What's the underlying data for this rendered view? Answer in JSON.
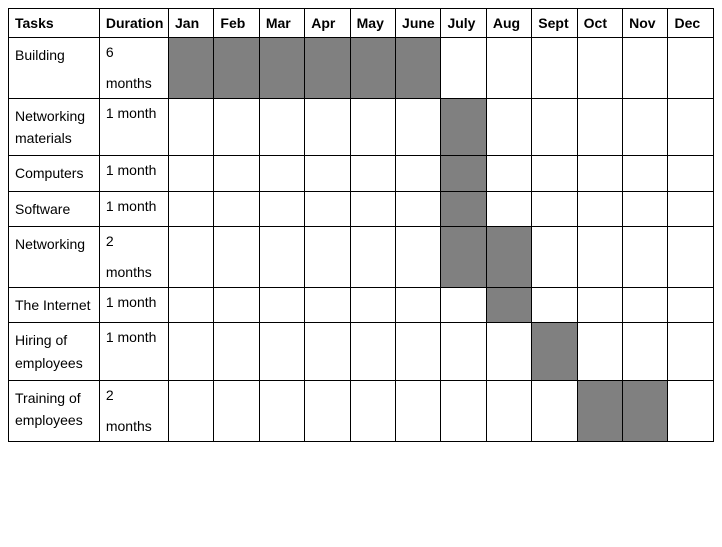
{
  "headers": {
    "tasks": "Tasks",
    "duration": "Duration",
    "months": [
      "Jan",
      "Feb",
      "Mar",
      "Apr",
      "May",
      "June",
      "July",
      "Aug",
      "Sept",
      "Oct",
      "Nov",
      "Dec"
    ]
  },
  "rows": [
    {
      "task": "Building",
      "duration": "6 months",
      "fill": [
        1,
        1,
        1,
        1,
        1,
        1,
        0,
        0,
        0,
        0,
        0,
        0
      ]
    },
    {
      "task": "Networking materials",
      "duration": "1 month",
      "fill": [
        0,
        0,
        0,
        0,
        0,
        0,
        1,
        0,
        0,
        0,
        0,
        0
      ]
    },
    {
      "task": "Computers",
      "duration": " 1 month",
      "fill": [
        0,
        0,
        0,
        0,
        0,
        0,
        1,
        0,
        0,
        0,
        0,
        0
      ]
    },
    {
      "task": "Software",
      "duration": "1 month",
      "fill": [
        0,
        0,
        0,
        0,
        0,
        0,
        1,
        0,
        0,
        0,
        0,
        0
      ]
    },
    {
      "task": "Networking",
      "duration": "2 months",
      "fill": [
        0,
        0,
        0,
        0,
        0,
        0,
        1,
        1,
        0,
        0,
        0,
        0
      ]
    },
    {
      "task": "The Internet",
      "duration": "1 month",
      "fill": [
        0,
        0,
        0,
        0,
        0,
        0,
        0,
        1,
        0,
        0,
        0,
        0
      ]
    },
    {
      "task": "Hiring of employees",
      "duration": "1 month",
      "fill": [
        0,
        0,
        0,
        0,
        0,
        0,
        0,
        0,
        1,
        0,
        0,
        0
      ]
    },
    {
      "task": "Training of employees",
      "duration": "2 months",
      "fill": [
        0,
        0,
        0,
        0,
        0,
        0,
        0,
        0,
        0,
        1,
        1,
        0
      ]
    }
  ],
  "chart_data": {
    "type": "bar",
    "title": "",
    "xlabel": "",
    "ylabel": "",
    "categories": [
      "Jan",
      "Feb",
      "Mar",
      "Apr",
      "May",
      "June",
      "July",
      "Aug",
      "Sept",
      "Oct",
      "Nov",
      "Dec"
    ],
    "series": [
      {
        "name": "Building",
        "start": "Jan",
        "end": "June",
        "duration_months": 6
      },
      {
        "name": "Networking materials",
        "start": "July",
        "end": "July",
        "duration_months": 1
      },
      {
        "name": "Computers",
        "start": "July",
        "end": "July",
        "duration_months": 1
      },
      {
        "name": "Software",
        "start": "July",
        "end": "July",
        "duration_months": 1
      },
      {
        "name": "Networking",
        "start": "July",
        "end": "Aug",
        "duration_months": 2
      },
      {
        "name": "The Internet",
        "start": "Aug",
        "end": "Aug",
        "duration_months": 1
      },
      {
        "name": "Hiring of employees",
        "start": "Sept",
        "end": "Sept",
        "duration_months": 1
      },
      {
        "name": "Training of employees",
        "start": "Oct",
        "end": "Nov",
        "duration_months": 2
      }
    ]
  }
}
